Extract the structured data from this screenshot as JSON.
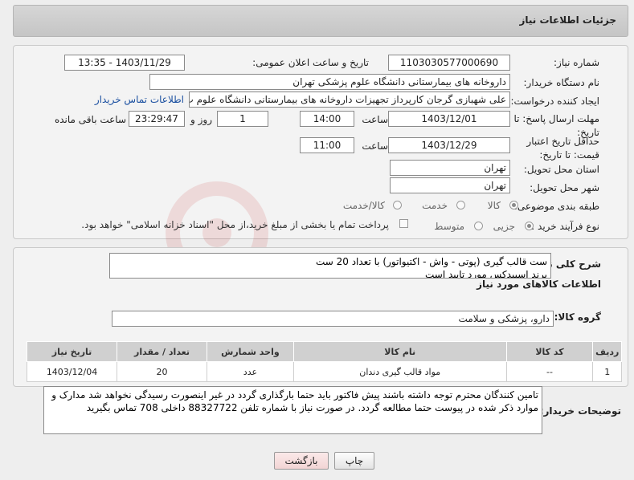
{
  "header": {
    "title": "جزئیات اطلاعات نیاز"
  },
  "fields": {
    "need_number_label": "شماره نیاز:",
    "need_number": "1103030577000690",
    "announce_label": "تاریخ و ساعت اعلان عمومی:",
    "announce_value": "1403/11/29 - 13:35",
    "buyer_org_label": "نام دستگاه خریدار:",
    "buyer_org": "داروخانه های بیمارستانی دانشگاه علوم پزشکی تهران",
    "creator_label": "ایجاد کننده درخواست:",
    "creator": "علی شهبازی گرجان کارپرداز تجهیزات داروخانه های بیمارستانی دانشگاه علوم پ",
    "contact_link": "اطلاعات تماس خریدار",
    "deadline_label": "مهلت ارسال پاسخ: تا تاریخ:",
    "deadline_date": "1403/12/01",
    "time_label": "ساعت",
    "deadline_time": "14:00",
    "days_value": "1",
    "days_label": "روز و",
    "remaining_value": "23:29:47",
    "remaining_label": "ساعت باقی مانده",
    "validity_label": "حداقل تاریخ اعتبار قیمت: تا تاریخ:",
    "validity_date": "1403/12/29",
    "validity_time": "11:00",
    "province_label": "استان محل تحویل:",
    "province": "تهران",
    "city_label": "شهر محل تحویل:",
    "city": "تهران",
    "category_label": "طبقه بندی موضوعی:",
    "category_options": [
      "کالا",
      "خدمت",
      "کالا/خدمت"
    ],
    "purchase_label": "نوع فرآیند خرید :",
    "purchase_options": [
      "جزیی",
      "متوسط"
    ],
    "purchase_note": "پرداخت تمام یا بخشی از مبلغ خرید،از محل \"اسناد خزانه اسلامی\" خواهد بود."
  },
  "description": {
    "label": "شرح کلی نیاز:",
    "text": "ست قالب گیری (پوتی - واش - اکتیواتور) با تعداد 20 ست\nبرند اسپیدکس مورد تایید است"
  },
  "goods": {
    "section_title": "اطلاعات کالاهای مورد نیاز",
    "group_label": "گروه کالا:",
    "group_value": "دارو، پزشکی و سلامت",
    "columns": [
      "ردیف",
      "کد کالا",
      "نام کالا",
      "واحد شمارش",
      "تعداد / مقدار",
      "تاریخ نیاز"
    ],
    "rows": [
      [
        "1",
        "--",
        "مواد قالب گیری دندان",
        "عدد",
        "20",
        "1403/12/04"
      ]
    ]
  },
  "buyer_notes": {
    "label": "توضیحات خریدار:",
    "text": "تامین کنندگان محترم توجه داشته باشند پیش فاکتور باید حتما بارگذاری گردد در غیر اینصورت رسیدگی نخواهد شد مدارک و موارد ذکر شده در پیوست حتما مطالعه گردد. در صورت نیاز با شماره تلفن 88327722 داخلی 708 تماس بگیرید"
  },
  "buttons": {
    "print": "چاپ",
    "back": "بازگشت"
  },
  "colors": {
    "link": "#1a4fa0",
    "back_button_bg": "#f7dede"
  }
}
